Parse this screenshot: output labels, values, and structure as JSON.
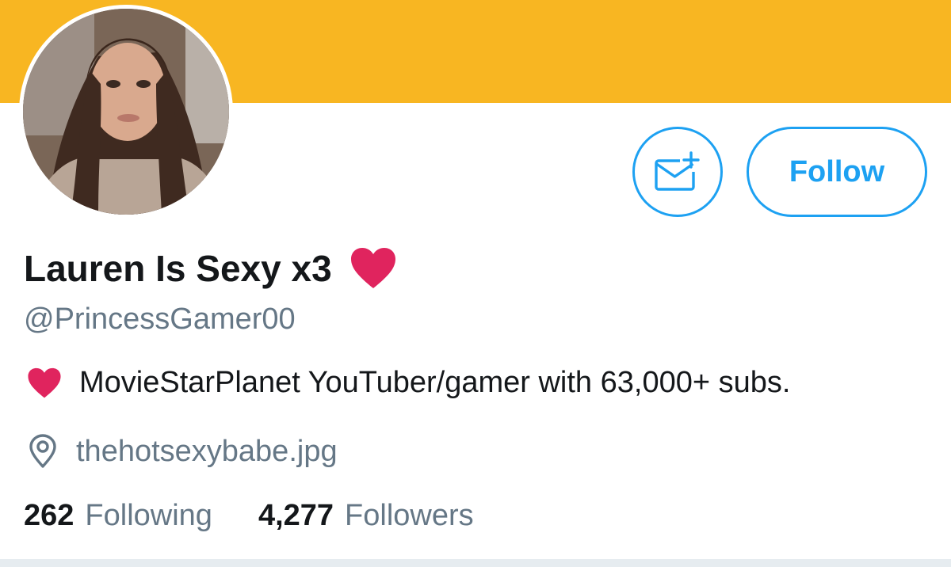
{
  "profile": {
    "display_name": "Lauren Is Sexy x3",
    "name_emoji": "red-heart",
    "handle": "@PrincessGamer00",
    "bio_emoji": "red-heart",
    "bio": "MovieStarPlanet YouTuber/gamer with 63,000+ subs.",
    "location": "thehotsexybabe.jpg"
  },
  "actions": {
    "message_icon": "envelope-plus-icon",
    "follow_label": "Follow"
  },
  "stats": {
    "following_count": "262",
    "following_label": "Following",
    "followers_count": "4,277",
    "followers_label": "Followers"
  },
  "colors": {
    "banner": "#f8b622",
    "accent": "#1da1f2",
    "heart": "#e0245e",
    "secondary_text": "#657786",
    "primary_text": "#14171a"
  }
}
